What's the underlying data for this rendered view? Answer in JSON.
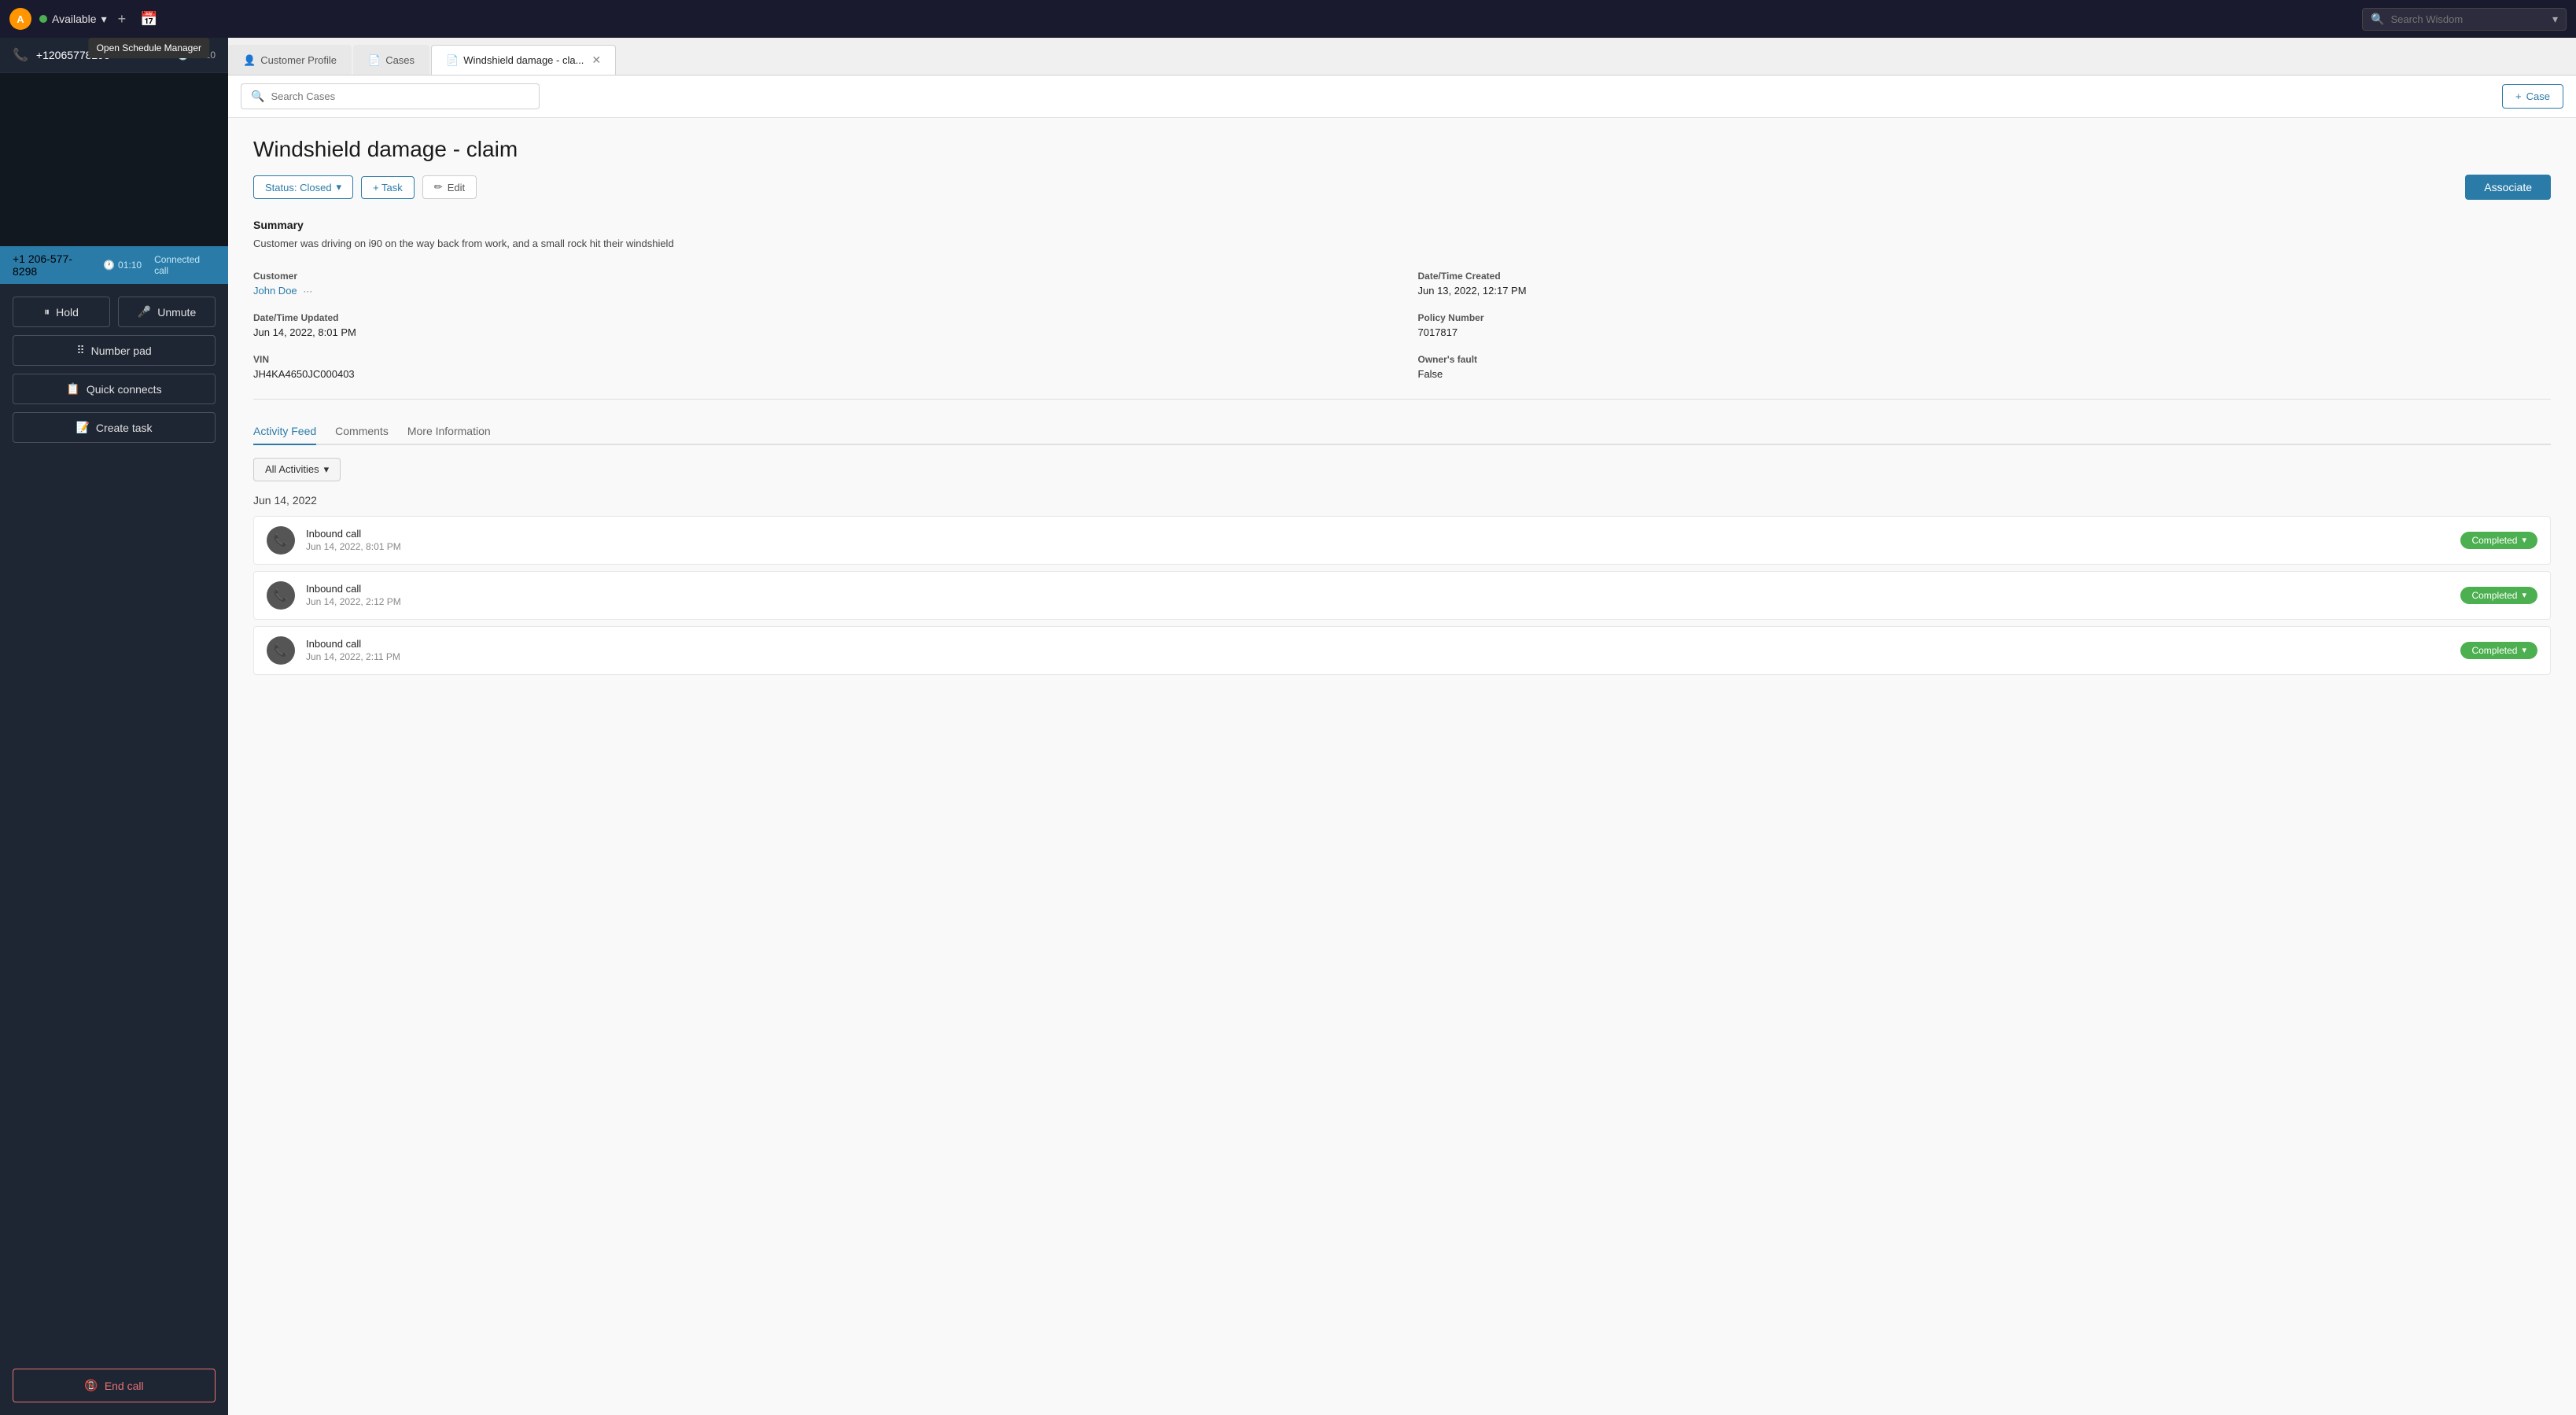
{
  "nav": {
    "logo_text": "A",
    "status_label": "Available",
    "status_color": "#4caf50",
    "schedule_tooltip": "Open Schedule Manager",
    "wisdom_placeholder": "Search Wisdom",
    "add_icon": "+",
    "settings_icon": "⚙"
  },
  "call": {
    "phone_number": "+12065778298",
    "timer_display": "01:10",
    "caller_number": "+1 206-577-8298",
    "caller_timer": "01:10",
    "connected_label": "Connected call"
  },
  "controls": {
    "hold_label": "Hold",
    "unmute_label": "Unmute",
    "number_pad_label": "Number pad",
    "quick_connects_label": "Quick connects",
    "create_task_label": "Create task",
    "end_call_label": "End call"
  },
  "tabs": [
    {
      "id": "customer",
      "label": "Customer Profile",
      "icon": "👤",
      "active": false,
      "closeable": false
    },
    {
      "id": "cases",
      "label": "Cases",
      "icon": "📄",
      "active": false,
      "closeable": false
    },
    {
      "id": "case-detail",
      "label": "Windshield damage - cla...",
      "icon": "📄",
      "active": true,
      "closeable": true
    }
  ],
  "search": {
    "placeholder": "Search Cases"
  },
  "add_case_label": "+ Case",
  "case": {
    "title": "Windshield damage - claim",
    "status_label": "Status: Closed",
    "task_label": "+ Task",
    "edit_label": "✏ Edit",
    "associate_label": "Associate",
    "summary_heading": "Summary",
    "summary_text": "Customer was driving on i90 on the way back from work, and a small rock hit their windshield",
    "fields": [
      {
        "label": "Customer",
        "value": "John Doe",
        "is_link": true,
        "has_ellipsis": true
      },
      {
        "label": "Date/Time Created",
        "value": "Jun 13, 2022, 12:17 PM",
        "is_link": false
      },
      {
        "label": "Date/Time Updated",
        "value": "Jun 14, 2022, 8:01 PM",
        "is_link": false
      },
      {
        "label": "Policy Number",
        "value": "7017817",
        "is_link": false
      },
      {
        "label": "VIN",
        "value": "JH4KA4650JC000403",
        "is_link": false
      },
      {
        "label": "Owner's fault",
        "value": "False",
        "is_link": false
      }
    ]
  },
  "activity_tabs": [
    {
      "id": "activity-feed",
      "label": "Activity Feed",
      "active": true
    },
    {
      "id": "comments",
      "label": "Comments",
      "active": false
    },
    {
      "id": "more-info",
      "label": "More Information",
      "active": false
    }
  ],
  "all_activities_label": "All Activities",
  "activity_date_group": "Jun 14, 2022",
  "activities": [
    {
      "type": "Inbound call",
      "time": "Jun 14, 2022, 8:01 PM",
      "status": "Completed"
    },
    {
      "type": "Inbound call",
      "time": "Jun 14, 2022, 2:12 PM",
      "status": "Completed"
    },
    {
      "type": "Inbound call",
      "time": "Jun 14, 2022, 2:11 PM",
      "status": "Completed"
    }
  ]
}
